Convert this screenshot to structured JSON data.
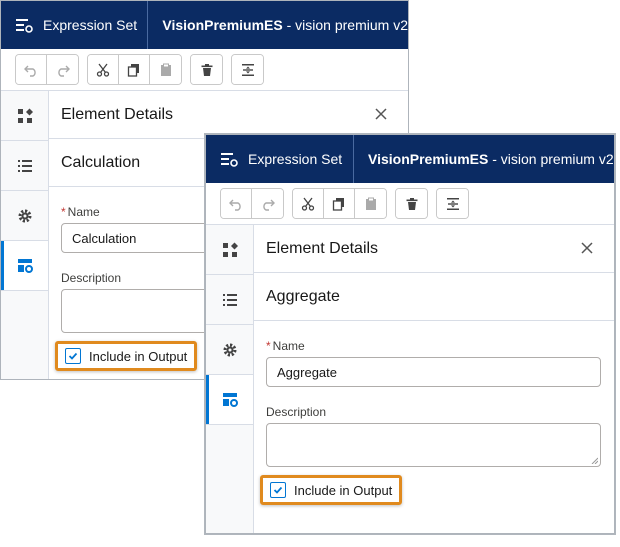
{
  "back_panel": {
    "app_name": "Expression Set",
    "set_name": "VisionPremiumES",
    "set_suffix": " - vision premium v2",
    "details_title": "Element Details",
    "element_type": "Calculation",
    "name_label": "Name",
    "name_value": "Calculation",
    "description_label": "Description",
    "description_value": "",
    "include_output_label": "Include in Output",
    "include_output_checked": true
  },
  "front_panel": {
    "app_name": "Expression Set",
    "set_name": "VisionPremiumES",
    "set_suffix": " - vision premium v2",
    "details_title": "Element Details",
    "element_type": "Aggregate",
    "name_label": "Name",
    "name_value": "Aggregate",
    "description_label": "Description",
    "description_value": "",
    "include_output_label": "Include in Output",
    "include_output_checked": true
  },
  "colors": {
    "header_bg": "#0b2b63",
    "highlight": "#e08a1e",
    "accent": "#0176d3"
  },
  "icons": [
    "list-icon",
    "undo-icon",
    "redo-icon",
    "cut-icon",
    "copy-icon",
    "paste-icon",
    "delete-icon",
    "fit-icon",
    "elements-icon",
    "resources-icon",
    "gear-icon",
    "details-icon",
    "close-icon",
    "check-icon"
  ]
}
